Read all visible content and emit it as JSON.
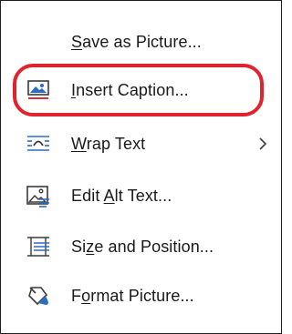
{
  "menu": {
    "items": [
      {
        "id": "save-as-picture",
        "label": "Save as Picture...",
        "mnemonic_index": 0,
        "icon": null,
        "has_submenu": false
      },
      {
        "id": "insert-caption",
        "label": "Insert Caption...",
        "mnemonic_index": 0,
        "icon": "insert-caption-icon",
        "has_submenu": false,
        "highlighted": true
      },
      {
        "id": "wrap-text",
        "label": "Wrap Text",
        "mnemonic_index": 0,
        "icon": "wrap-text-icon",
        "has_submenu": true
      },
      {
        "id": "edit-alt-text",
        "label": "Edit Alt Text...",
        "mnemonic_index": 5,
        "icon": "alt-text-icon",
        "has_submenu": false
      },
      {
        "id": "size-and-position",
        "label": "Size and Position...",
        "mnemonic_index": 2,
        "icon": "size-position-icon",
        "has_submenu": false
      },
      {
        "id": "format-picture",
        "label": "Format Picture...",
        "mnemonic_index": 1,
        "icon": "format-picture-icon",
        "has_submenu": false
      }
    ]
  },
  "colors": {
    "highlight_ring": "#e0242f",
    "icon_blue": "#2b6cc4",
    "icon_dark": "#3a3a3a",
    "icon_red": "#d13438",
    "text": "#1a1a1a",
    "border": "#1f1f1f"
  }
}
